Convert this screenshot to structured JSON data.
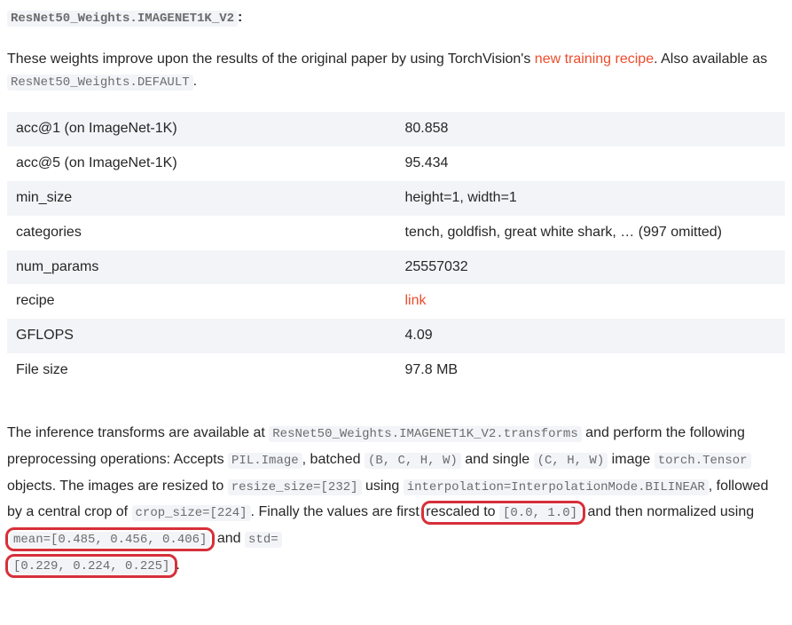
{
  "heading_code": "ResNet50_Weights.IMAGENET1K_V2",
  "heading_colon": ":",
  "intro": {
    "p1_a": "These weights improve upon the results of the original paper by using TorchVision's ",
    "recipe_link": "new training recipe",
    "p1_b": ". Also available as ",
    "default_code": "ResNet50_Weights.DEFAULT",
    "p1_c": "."
  },
  "rows": [
    {
      "k": "acc@1 (on ImageNet-1K)",
      "v": "80.858"
    },
    {
      "k": "acc@5 (on ImageNet-1K)",
      "v": "95.434"
    },
    {
      "k": "min_size",
      "v": "height=1, width=1"
    },
    {
      "k": "categories",
      "v": "tench, goldfish, great white shark, … (997 omitted)"
    },
    {
      "k": "num_params",
      "v": "25557032"
    },
    {
      "k": "recipe",
      "v": "link",
      "is_link": true
    },
    {
      "k": "GFLOPS",
      "v": "4.09"
    },
    {
      "k": "File size",
      "v": "97.8 MB"
    }
  ],
  "tf": {
    "a": "The inference transforms are available at ",
    "c1": "ResNet50_Weights.IMAGENET1K_V2.transforms",
    "b": " and perform the following preprocessing operations: Accepts ",
    "c2": "PIL.Image",
    "c": ", batched ",
    "c3": "(B, C, H, W)",
    "d": " and single ",
    "c4": "(C, H, W)",
    "e": " image ",
    "c5": "torch.Tensor",
    "f": " objects. The images are resized to ",
    "c6": "resize_size=[232]",
    "g": " using ",
    "c7": "interpolation=InterpolationMode.BILINEAR",
    "h": ", followed by a central crop of ",
    "c8": "crop_size=[224]",
    "i": ". Finally the values are first ",
    "hl1_a": "rescaled to ",
    "hl1_code": "[0.0, 1.0]",
    "j": " and then normalized using ",
    "hl2_code": "mean=[0.485, 0.456, 0.406]",
    "k": " and ",
    "c9": "std=",
    "hl3_code": "[0.229, 0.224, 0.225]",
    "l": "."
  }
}
